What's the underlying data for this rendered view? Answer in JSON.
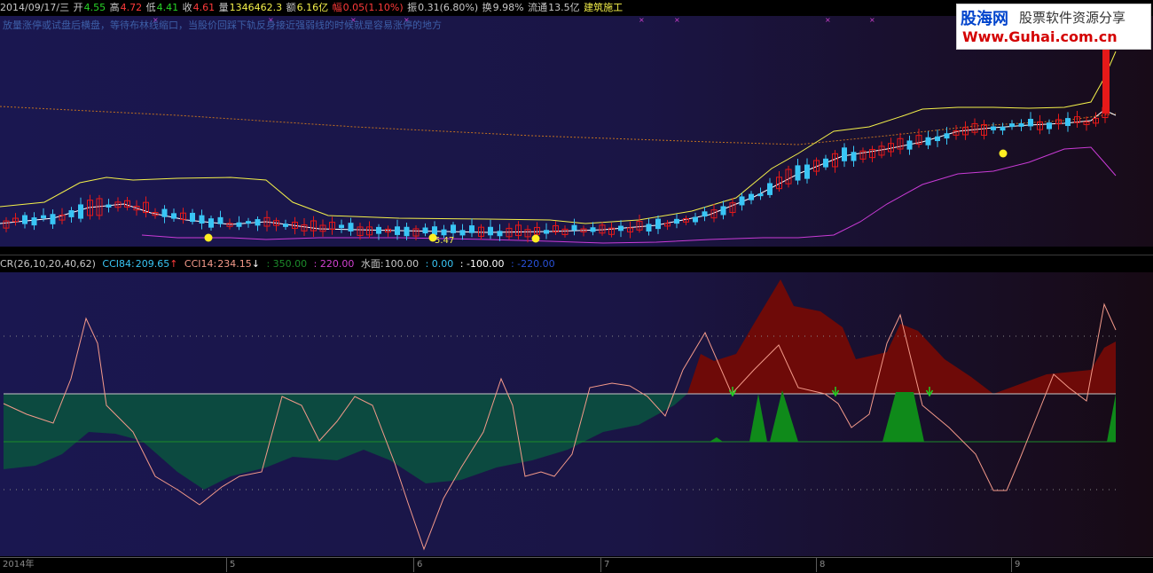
{
  "info_bar": {
    "date": "2014/09/17/三",
    "open_label": "开",
    "open_value": "4.55",
    "high_label": "高",
    "high_value": "4.72",
    "low_label": "低",
    "low_value": "4.41",
    "close_label": "收",
    "close_value": "4.61",
    "volume_label": "量",
    "volume_value": "1346462.3",
    "amount_label": "额",
    "amount_value": "6.16亿",
    "change_label": "幅",
    "change_value": "0.05(1.10%)",
    "amplitude_label": "振",
    "amplitude_value": "0.31(6.80%)",
    "turnover_label": "换",
    "turnover_value": "9.98%",
    "float_label": "流通",
    "float_value": "13.5亿",
    "sector": "建筑施工"
  },
  "hint_text": "放量涨停或试盘后横盘，等待布林线缩口，当股价回踩下轨反身接近强弱线的时候就是容易涨停的地方",
  "price_marker": "5.47",
  "signal_marker": "$",
  "logo": {
    "name": "股海网",
    "slogan": "股票软件资源分享",
    "url": "Www.Guhai.com.cn"
  },
  "indicator_header": {
    "name": "CR(26,10,20,40,62)",
    "cci84_label": "CCI84:",
    "cci84_value": "209.65",
    "cci84_arrow": "↑",
    "cci14_label": "CCI14:",
    "cci14_value": "234.15",
    "cci14_arrow": "↓",
    "l350": ": 350.00",
    "l220": ": 220.00",
    "water_label": "水面:",
    "water_value": "100.00",
    "zero": ": 0.00",
    "neg100": ": -100.00",
    "neg220": ": -220.00"
  },
  "time_axis": {
    "labels": [
      "2014年",
      "5",
      "6",
      "7",
      "8",
      "9"
    ]
  },
  "colors": {
    "bg_top": "#18154a",
    "bg_right": "#170a14",
    "bull": "#e61919",
    "bear": "#39c5f5",
    "boll_upper": "#f4f04a",
    "boll_mid": "#ffffff",
    "boll_lower": "#c93bd6",
    "ma_dotted": "#c07020",
    "cr_red_fill": "#6e0a08",
    "cr_teal_fill": "#0c4a40",
    "cr_line": "#f49a8a",
    "spike_green": "#0f8a1a",
    "arrow_green": "#22d022",
    "level_line": "#c8c8c8"
  },
  "chart_data": {
    "type": "candlestick",
    "series": [
      {
        "name": "CCI84",
        "last": 209.65
      },
      {
        "name": "CCI14",
        "last": 234.15
      }
    ],
    "levels": [
      350,
      220,
      100,
      0,
      -100,
      -220
    ],
    "last_candle": {
      "open": 4.55,
      "high": 4.72,
      "low": 4.41,
      "close": 4.61
    }
  }
}
